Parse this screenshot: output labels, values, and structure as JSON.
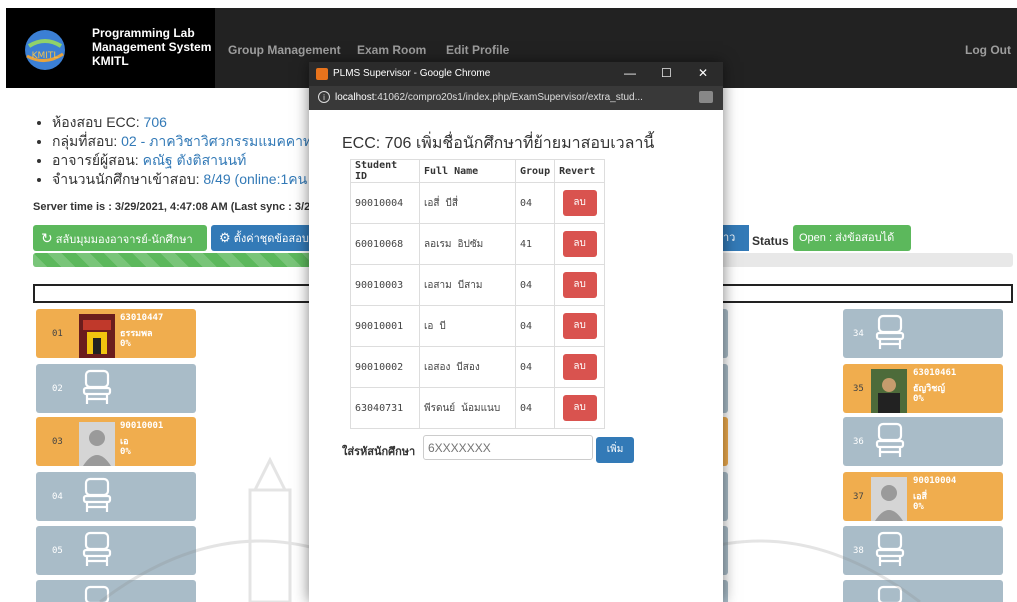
{
  "nav": {
    "brand_line1": "Programming Lab",
    "brand_line2": "Management System",
    "brand_line3": "KMITL",
    "logo_text": "KMITL",
    "items": [
      "Group Management",
      "Exam Room",
      "Edit Profile"
    ],
    "logout": "Log Out"
  },
  "info": {
    "room_label": "ห้องสอบ ECC:",
    "room_value": "706",
    "group_label": "กลุ่มที่สอบ:",
    "group_value": "02 - ภาควิชาวิศวกรรมแมคคาทร",
    "teacher_label": "อาจารย์ผู้สอน:",
    "teacher_value": "คณัฐ ตังติสานนท์",
    "count_label": "จำนวนนักศึกษาเข้าสอบ:",
    "count_value": "8/49 (online:1คน"
  },
  "server_time": "Server time is : 3/29/2021, 4:47:08 AM (Last sync : 3/29",
  "buttons": {
    "switch_view": "สลับมุมมองอาจารย์-นักศึกษา",
    "settings": "ตั้งค่าชุดข้อสอบ",
    "right_blue": "าว"
  },
  "status": {
    "label": "Status :",
    "value": "Open : ส่งข้อสอบได้"
  },
  "progress": {
    "fraction": 0.65
  },
  "seats": {
    "left": [
      {
        "num": "01",
        "taken": true,
        "sid": "63010447",
        "name": "ธรรมพล",
        "pct": "0%",
        "photo": "temple"
      },
      {
        "num": "02",
        "taken": false
      },
      {
        "num": "03",
        "taken": true,
        "sid": "90010001",
        "name": "เอ",
        "pct": "0%",
        "photo": "avatar"
      },
      {
        "num": "04",
        "taken": false
      },
      {
        "num": "05",
        "taken": false
      },
      {
        "num": "",
        "taken": false
      }
    ],
    "right": [
      {
        "num": "34",
        "taken": false
      },
      {
        "num": "35",
        "taken": true,
        "sid": "63010461",
        "name": "ธัญวิชญ์",
        "pct": "0%",
        "photo": "person"
      },
      {
        "num": "36",
        "taken": false
      },
      {
        "num": "37",
        "taken": true,
        "sid": "90010004",
        "name": "เอสี่",
        "pct": "0%",
        "photo": "avatar"
      },
      {
        "num": "38",
        "taken": false
      },
      {
        "num": "",
        "taken": false
      }
    ]
  },
  "popup": {
    "window_title": "PLMS Supervisor - Google Chrome",
    "url_host": "localhost",
    "url_rest": ":41062/compro20s1/index.php/ExamSupervisor/extra_stud...",
    "heading": "ECC: 706 เพิ่มชื่อนักศึกษาที่ย้ายมาสอบเวลานี้",
    "columns": [
      "Student ID",
      "Full Name",
      "Group",
      "Revert"
    ],
    "rows": [
      {
        "id": "90010004",
        "name": "เอสี่ บีสี่",
        "group": "04",
        "action": "ลบ"
      },
      {
        "id": "60010068",
        "name": "ลอเรม อิปซัม",
        "group": "41",
        "action": "ลบ"
      },
      {
        "id": "90010003",
        "name": "เอสาม บีสาม",
        "group": "04",
        "action": "ลบ"
      },
      {
        "id": "90010001",
        "name": "เอ บี",
        "group": "04",
        "action": "ลบ"
      },
      {
        "id": "90010002",
        "name": "เอสอง บีสอง",
        "group": "04",
        "action": "ลบ"
      },
      {
        "id": "63040731",
        "name": "พีรดนย์ น้อมแนบ",
        "group": "04",
        "action": "ลบ"
      }
    ],
    "add_label": "ใส่รหัสนักศึกษา",
    "add_placeholder": "6XXXXXXX",
    "add_button": "เพิ่ม"
  },
  "colors": {
    "nav_bg": "#222222",
    "brand_bg": "#000000",
    "seat_empty": "#a9bcc8",
    "seat_taken": "#f0ad4e",
    "green": "#5cb85c",
    "blue": "#337ab7",
    "red": "#d9534f"
  }
}
